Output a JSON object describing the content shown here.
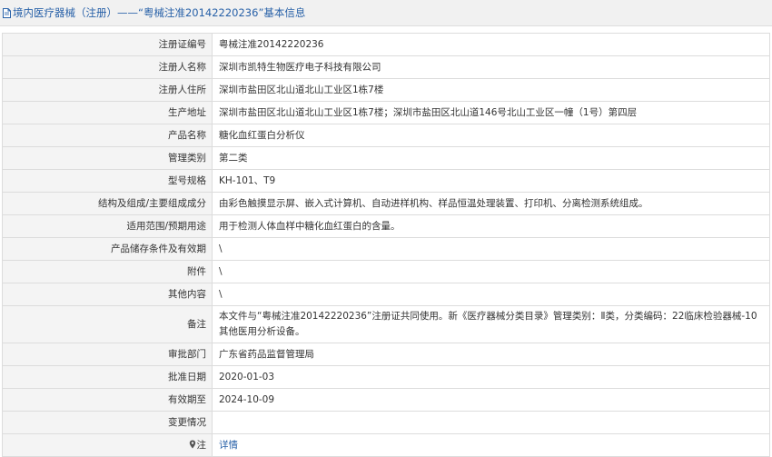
{
  "header": {
    "title": "境内医疗器械（注册）——“粤械注准20142220236”基本信息"
  },
  "rows": [
    {
      "label": "注册证编号",
      "value": "粤械注准20142220236"
    },
    {
      "label": "注册人名称",
      "value": "深圳市凯特生物医疗电子科技有限公司"
    },
    {
      "label": "注册人住所",
      "value": "深圳市盐田区北山道北山工业区1栋7楼"
    },
    {
      "label": "生产地址",
      "value": "深圳市盐田区北山道北山工业区1栋7楼；深圳市盐田区北山道146号北山工业区一幢（1号）第四层"
    },
    {
      "label": "产品名称",
      "value": "糖化血红蛋白分析仪"
    },
    {
      "label": "管理类别",
      "value": "第二类"
    },
    {
      "label": "型号规格",
      "value": "KH-101、T9"
    },
    {
      "label": "结构及组成/主要组成成分",
      "value": "由彩色触摸显示屏、嵌入式计算机、自动进样机构、样品恒温处理装置、打印机、分离检测系统组成。"
    },
    {
      "label": "适用范围/预期用途",
      "value": "用于检测人体血样中糖化血红蛋白的含量。"
    },
    {
      "label": "产品储存条件及有效期",
      "value": "\\"
    },
    {
      "label": "附件",
      "value": "\\"
    },
    {
      "label": "其他内容",
      "value": "\\"
    },
    {
      "label": "备注",
      "value": "本文件与“粤械注准20142220236”注册证共同使用。新《医疗器械分类目录》管理类别：Ⅱ类，分类编码：22临床检验器械-10其他医用分析设备。"
    },
    {
      "label": "审批部门",
      "value": "广东省药品监督管理局"
    },
    {
      "label": "批准日期",
      "value": "2020-01-03"
    },
    {
      "label": "有效期至",
      "value": "2024-10-09"
    },
    {
      "label": "变更情况",
      "value": ""
    },
    {
      "label": "注",
      "value": "详情"
    }
  ],
  "colors": {
    "link": "#2861a8",
    "label_bg": "#f4f4f4",
    "border": "#dcdcdc"
  },
  "icons": {
    "header": "document-icon",
    "note": "map-pin-icon"
  }
}
